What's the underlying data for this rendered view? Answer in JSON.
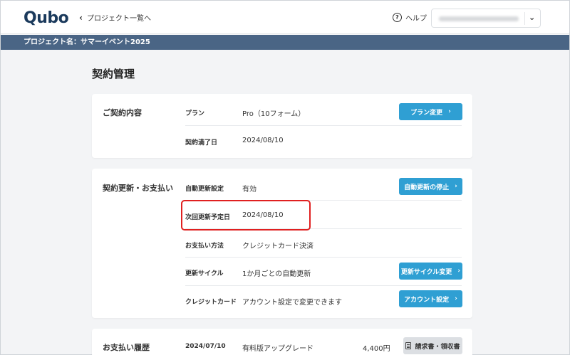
{
  "header": {
    "logo": "Qubo",
    "back_link": "プロジェクト一覧へ",
    "help": "ヘルプ"
  },
  "project_bar": {
    "label": "プロジェクト名：サマーイベント2025"
  },
  "page_title": "契約管理",
  "contract": {
    "title": "ご契約内容",
    "rows": [
      {
        "label": "プラン",
        "value": "Pro（10フォーム）",
        "button": "プラン変更"
      },
      {
        "label": "契約満了日",
        "value": "2024/08/10"
      }
    ]
  },
  "renewal": {
    "title": "契約更新・お支払い",
    "rows": [
      {
        "label": "自動更新設定",
        "value": "有効",
        "button": "自動更新の停止"
      },
      {
        "label": "次回更新予定日",
        "value": "2024/08/10"
      },
      {
        "label": "お支払い方法",
        "value": "クレジットカード決済"
      },
      {
        "label": "更新サイクル",
        "value": "1か月ごとの自動更新",
        "button": "更新サイクル変更"
      },
      {
        "label": "クレジットカード",
        "value": "アカウント設定で変更できます",
        "button": "アカウント設定"
      }
    ]
  },
  "history": {
    "title": "お支払い履歴",
    "rows": [
      {
        "date": "2024/07/10",
        "description": "有料版アップグレード",
        "amount": "4,400円",
        "button": "請求書・領収書"
      }
    ]
  },
  "colors": {
    "accent": "#2f9fd3",
    "project_bar": "#4a6585",
    "highlight": "#e02020"
  },
  "icons": {
    "back": "chevron-left-icon",
    "help": "help-circle-icon",
    "dropdown": "chevron-down-icon",
    "document": "document-icon"
  }
}
